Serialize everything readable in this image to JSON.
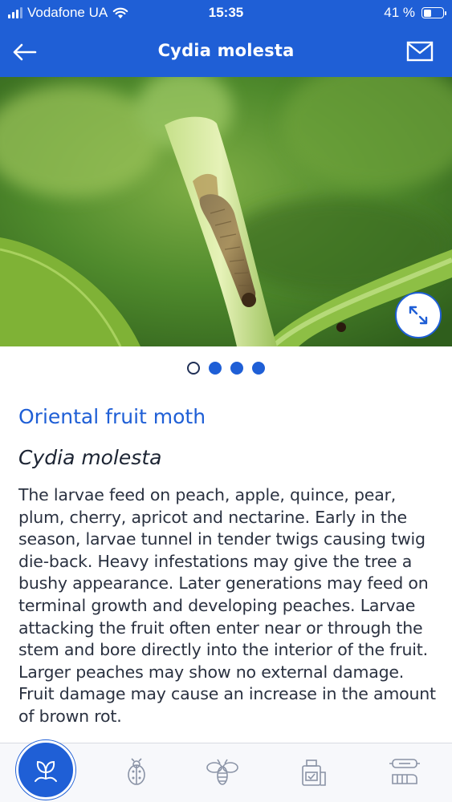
{
  "status_bar": {
    "carrier": "Vodafone UA",
    "time": "15:35",
    "battery_percent": "41 %",
    "battery_level": 0.41,
    "signal_bars": 3
  },
  "header": {
    "title": "Cydia molesta",
    "back_icon": "arrow-left-icon",
    "mail_icon": "mail-icon"
  },
  "gallery": {
    "image_count": 4,
    "active_index": 0,
    "expand_icon": "expand-arrows-icon"
  },
  "content": {
    "common_name": "Oriental fruit moth",
    "latin_name": "Cydia molesta",
    "description": "The larvae feed on peach, apple, quince, pear, plum, cherry, apricot and nectarine. Early in the season, larvae tunnel in tender twigs causing twig die-back. Heavy infestations may give the tree a bushy appearance. Later generations may feed on terminal growth and developing peaches. Larvae attacking the fruit often enter near or through the stem and bore directly into the interior of the fruit. Larger peaches may show no external damage. Fruit damage may cause an increase in the amount of brown rot."
  },
  "tab_bar": {
    "tabs": [
      {
        "icon": "plant-hand-icon",
        "active": true
      },
      {
        "icon": "beetle-icon",
        "active": false
      },
      {
        "icon": "bee-icon",
        "active": false
      },
      {
        "icon": "pesticide-bottle-icon",
        "active": false
      },
      {
        "icon": "protective-gear-icon",
        "active": false
      }
    ]
  },
  "colors": {
    "brand": "#1f5fd6",
    "text": "#2a3140"
  }
}
